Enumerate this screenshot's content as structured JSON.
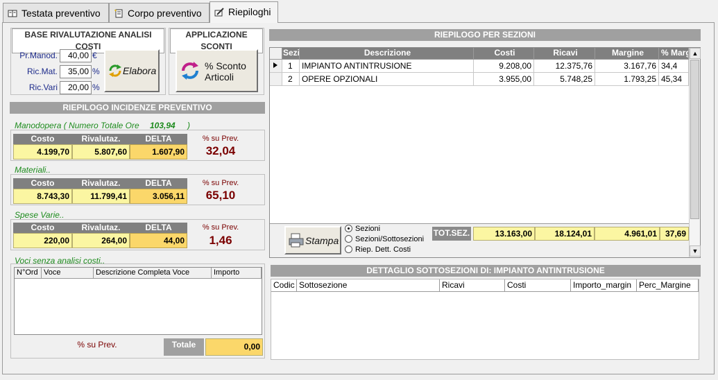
{
  "tabs": [
    {
      "label": "Testata preventivo",
      "icon": "book-icon"
    },
    {
      "label": "Corpo preventivo",
      "icon": "document-icon"
    },
    {
      "label": "Riepiloghi",
      "icon": "edit-icon"
    }
  ],
  "base": {
    "title": "BASE RIVALUTAZIONE ANALISI COSTI",
    "fields": [
      {
        "label": "Pr.Manod.",
        "value": "40,00",
        "unit": "€"
      },
      {
        "label": "Ric.Mat.",
        "value": "35,00",
        "unit": "%"
      },
      {
        "label": "Ric.Vari",
        "value": "20,00",
        "unit": "%"
      }
    ],
    "elabora": "Elabora"
  },
  "sconti": {
    "title": "APPLICAZIONE SCONTI",
    "button_line1": "% Sconto",
    "button_line2": "Articoli"
  },
  "incidenze": {
    "title": "RIEPILOGO INCIDENZE PREVENTIVO",
    "col_costo": "Costo",
    "col_rival": "Rivalutaz.",
    "col_delta": "DELTA",
    "pct_label": "% su Prev.",
    "manodopera": {
      "label": "Manodopera ( Numero Totale Ore",
      "ore": "103,94",
      "close": ")",
      "costo": "4.199,70",
      "rival": "5.807,60",
      "delta": "1.607,90",
      "pct": "32,04"
    },
    "materiali": {
      "label": "Materiali..",
      "costo": "8.743,30",
      "rival": "11.799,41",
      "delta": "3.056,11",
      "pct": "65,10"
    },
    "spese": {
      "label": "Spese Varie..",
      "costo": "220,00",
      "rival": "264,00",
      "delta": "44,00",
      "pct": "1,46"
    }
  },
  "voci": {
    "label": "Voci senza analisi costi..",
    "columns": [
      "N°Ord",
      "Voce",
      "Descrizione Completa Voce",
      "Importo"
    ],
    "pct_label": "% su Prev.",
    "totale_label": "Totale",
    "totale_value": "0,00"
  },
  "sezioni": {
    "title": "RIEPILOGO PER SEZIONI",
    "columns": [
      "Sezio",
      "Descrizione",
      "Costi",
      "Ricavi",
      "Margine",
      "% Marg"
    ],
    "rows": [
      {
        "sez": "1",
        "desc": "IMPIANTO ANTINTRUSIONE",
        "costi": "9.208,00",
        "ricavi": "12.375,76",
        "margine": "3.167,76",
        "perc": "34,4"
      },
      {
        "sez": "2",
        "desc": "OPERE OPZIONALI",
        "costi": "3.955,00",
        "ricavi": "5.748,25",
        "margine": "1.793,25",
        "perc": "45,34"
      }
    ],
    "stampa": "Stampa",
    "radio": [
      "Sezioni",
      "Sezioni/Sottosezioni",
      "Riep. Dett. Costi"
    ],
    "tot_label": "TOT.SEZ.",
    "tot": {
      "costi": "13.163,00",
      "ricavi": "18.124,01",
      "margine": "4.961,01",
      "perc": "37,69"
    }
  },
  "dettaglio": {
    "title": "DETTAGLIO SOTTOSEZIONI DI: IMPIANTO ANTINTRUSIONE",
    "columns": [
      "Codic",
      "Sottosezione",
      "Ricavi",
      "Costi",
      "Importo_margin",
      "Perc_Margine"
    ]
  }
}
